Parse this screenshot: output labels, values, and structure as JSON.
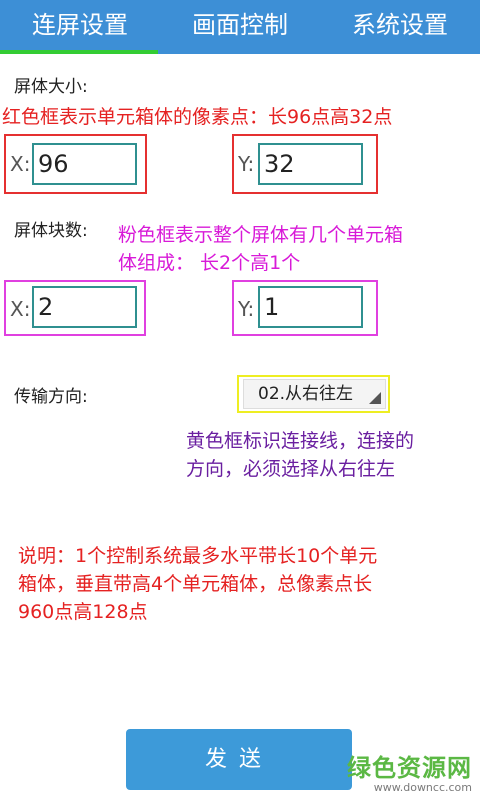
{
  "tabs": [
    {
      "label": "连屏设置",
      "active": true
    },
    {
      "label": "画面控制",
      "active": false
    },
    {
      "label": "系统设置",
      "active": false
    }
  ],
  "screen_size": {
    "label": "屏体大小:",
    "annotation": "红色框表示单元箱体的像素点：长96点高32点",
    "x_label": "X:",
    "x_value": "96",
    "y_label": "Y:",
    "y_value": "32"
  },
  "screen_blocks": {
    "label": "屏体块数:",
    "annotation_line1": "粉色框表示整个屏体有几个单元箱",
    "annotation_line2": "体组成：  长2个高1个",
    "x_label": "X:",
    "x_value": "2",
    "y_label": "Y:",
    "y_value": "1"
  },
  "direction": {
    "label": "传输方向:",
    "selected": "02.从右往左",
    "annotation_line1": "黄色框标识连接线，连接的",
    "annotation_line2": "方向，必须选择从右往左"
  },
  "note": {
    "line1": "说明：1个控制系统最多水平带长10个单元",
    "line2": "箱体，垂直带高4个单元箱体，总像素点长",
    "line3": "960点高128点"
  },
  "send_label": "发送",
  "watermark": {
    "logo": "绿色资源网",
    "url": "www.downcc.com"
  },
  "colors": {
    "tab_bar": "#3d8fd6",
    "tab_indicator": "#33cc33",
    "red_annotation": "#e52222",
    "pink_annotation": "#d81ad8",
    "purple_annotation": "#6a1fa0",
    "input_border": "#2f9090",
    "send_button": "#3d9ad9"
  }
}
